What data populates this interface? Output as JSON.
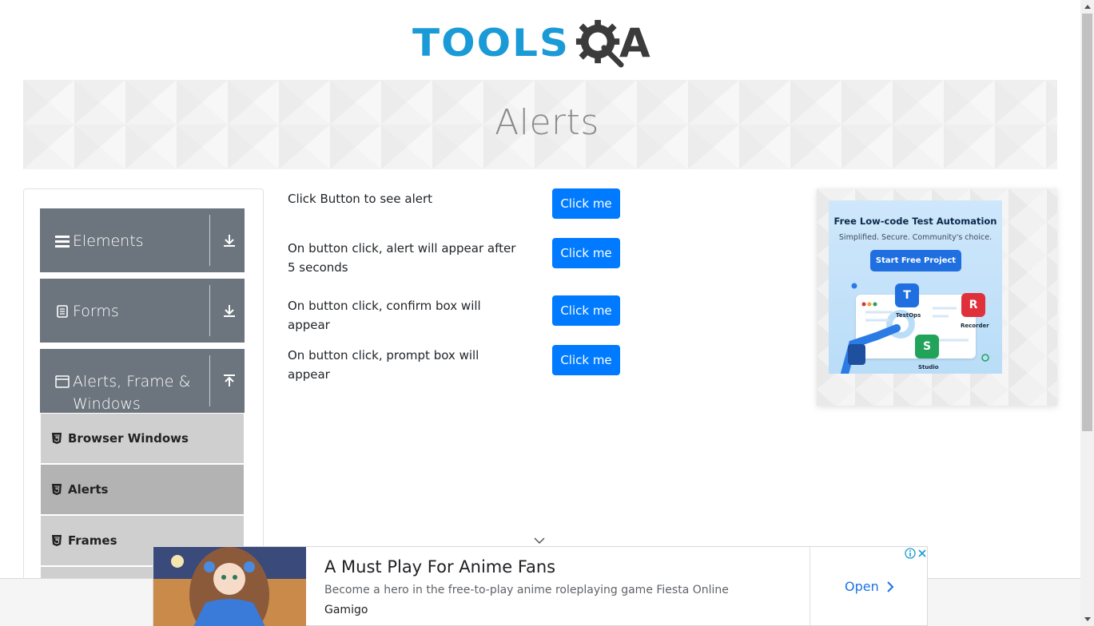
{
  "header": {
    "logo_text_primary": "TOOLS",
    "logo_text_secondary": "A",
    "logo_primary_color": "#1a9ad6",
    "logo_secondary_color": "#3b3b3b"
  },
  "banner": {
    "title": "Alerts"
  },
  "sidebar": {
    "groups": [
      {
        "label": "Elements",
        "icon": "hamburger-icon",
        "arrow": "download-arrow-icon"
      },
      {
        "label": "Forms",
        "icon": "document-icon",
        "arrow": "download-arrow-icon"
      },
      {
        "label_line1": "Alerts, Frame &",
        "label_line2": "Windows",
        "icon": "browser-window-icon",
        "arrow": "upload-arrow-icon"
      }
    ],
    "items": [
      {
        "label": "Browser Windows",
        "icon": "html5-icon"
      },
      {
        "label": "Alerts",
        "icon": "html5-icon",
        "active": true
      },
      {
        "label": "Frames",
        "icon": "html5-icon"
      }
    ]
  },
  "main": {
    "rows": [
      {
        "label": "Click Button to see alert",
        "button": "Click me"
      },
      {
        "label": "On button click, alert will appear after 5 seconds",
        "button": "Click me"
      },
      {
        "label": "On button click, confirm box will appear",
        "button": "Click me"
      },
      {
        "label": "On button click, prompt box will appear",
        "button": "Click me"
      }
    ],
    "button_color": "#007bff"
  },
  "side_ad": {
    "title": "Free Low-code Test Automation",
    "subtitle": "Simplified. Secure. Community's choice.",
    "cta": "Start Free Project",
    "badges": [
      {
        "letter": "T",
        "label": "TestOps",
        "color": "#1f6fe0"
      },
      {
        "letter": "R",
        "label": "Recorder",
        "color": "#e0303a"
      },
      {
        "letter": "S",
        "label": "Studio",
        "color": "#22a35a"
      }
    ]
  },
  "bottom_ad": {
    "headline": "A Must Play For Anime Fans",
    "description": "Become a hero in the free-to-play anime roleplaying game Fiesta Online",
    "advertiser": "Gamigo",
    "cta": "Open"
  }
}
